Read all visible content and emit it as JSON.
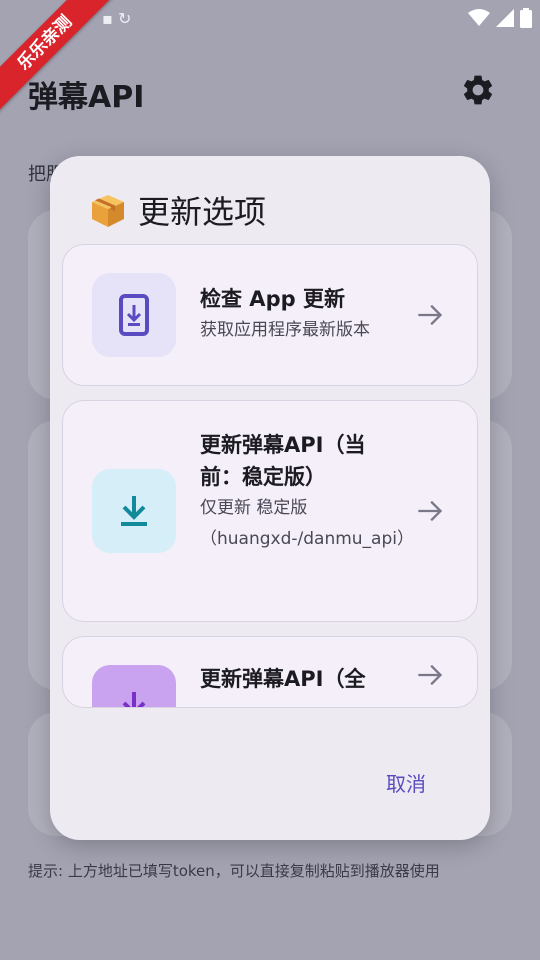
{
  "status_bar": {
    "left_icons": [
      "photo-icon",
      "sync-icon"
    ],
    "right_icons": [
      "wifi-icon",
      "signal-icon",
      "battery-icon"
    ]
  },
  "ribbon": {
    "text": "乐乐亲测"
  },
  "app": {
    "title": "弹幕API",
    "hint_top": "把服",
    "hint_bottom": "提示: 上方地址已填写token，可以直接复制粘贴到播放器使用"
  },
  "dialog": {
    "title": "更新选项",
    "title_emoji": "📦",
    "options": [
      {
        "title": "检查 App 更新",
        "desc": "获取应用程序最新版本",
        "icon": "phone-download-icon"
      },
      {
        "title": "更新弹幕API（当前：稳定版）",
        "desc": "仅更新 稳定版（huangxd-/danmu_api）",
        "icon": "download-icon"
      },
      {
        "title": "更新弹幕API（全",
        "icon": "download-icon"
      }
    ],
    "cancel_label": "取消"
  },
  "colors": {
    "accent": "#5a4cc0",
    "ribbon": "#d9242b",
    "icon_bg_1": "#e6e2f7",
    "icon_bg_2": "#d6eef7",
    "icon_bg_3": "#c9a3f0"
  }
}
